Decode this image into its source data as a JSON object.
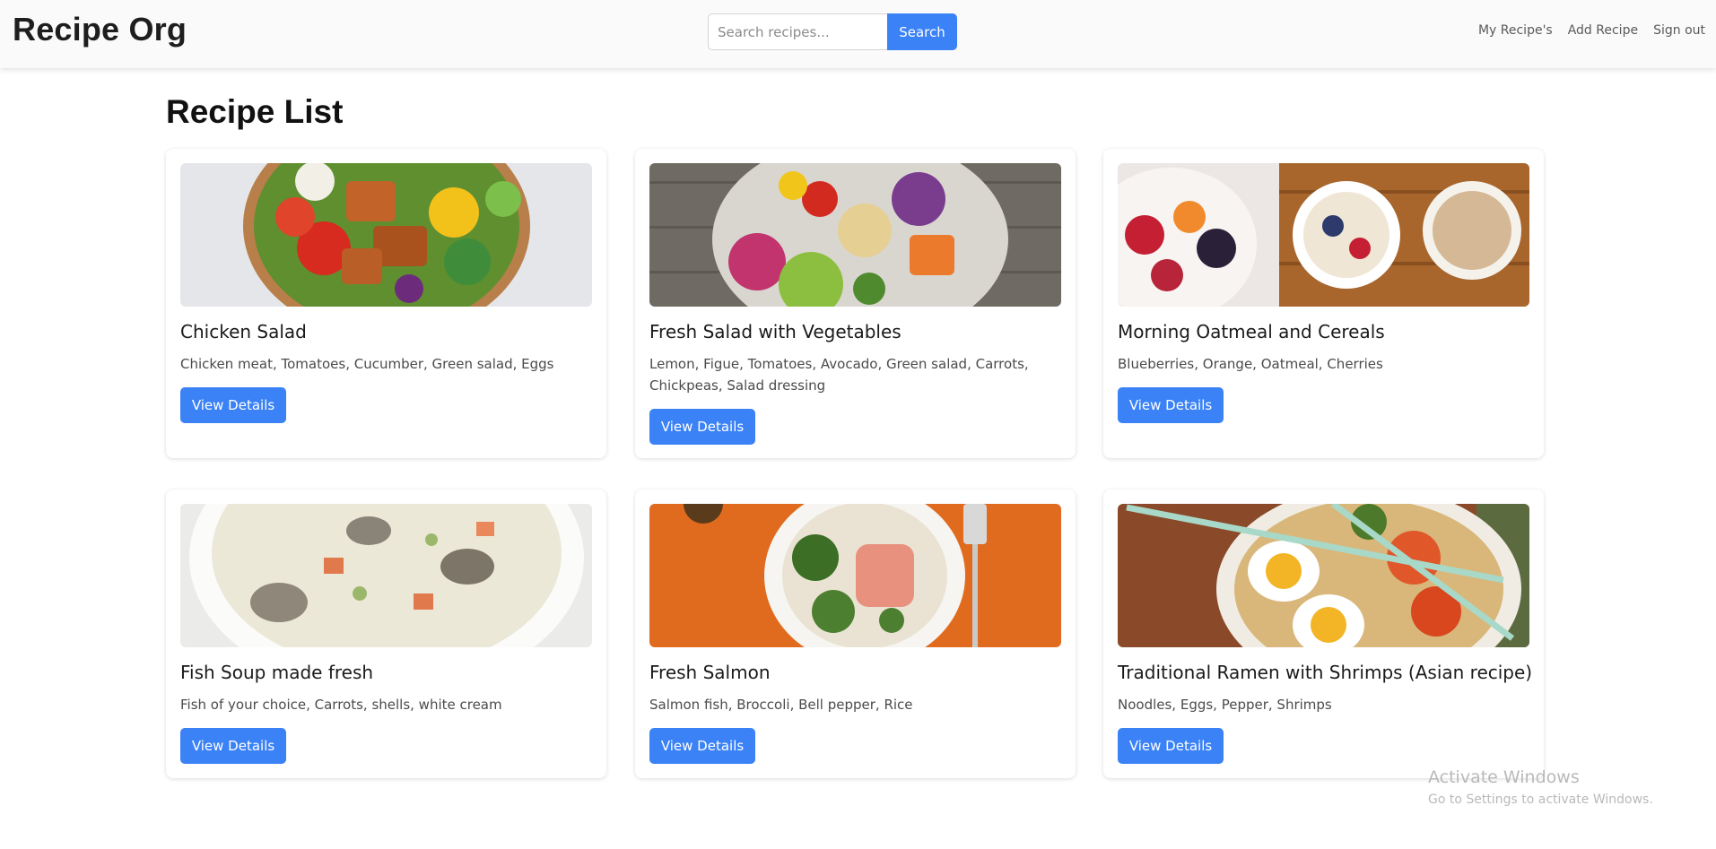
{
  "header": {
    "brand": "Recipe Org",
    "search_placeholder": "Search recipes...",
    "search_button": "Search",
    "nav": [
      "My Recipe's",
      "Add Recipe",
      "Sign out"
    ]
  },
  "main": {
    "title": "Recipe List",
    "recipes": [
      {
        "title": "Chicken Salad",
        "ingredients": "Chicken meat, Tomatoes, Cucumber, Green salad, Eggs",
        "button": "View Details"
      },
      {
        "title": "Fresh Salad with Vegetables",
        "ingredients": "Lemon, Figue, Tomatoes, Avocado, Green salad, Carrots, Chickpeas, Salad dressing",
        "button": "View Details"
      },
      {
        "title": "Morning Oatmeal and Cereals",
        "ingredients": "Blueberries, Orange, Oatmeal, Cherries",
        "button": "View Details"
      },
      {
        "title": "Fish Soup made fresh",
        "ingredients": "Fish of your choice, Carrots, shells, white cream",
        "button": "View Details"
      },
      {
        "title": "Fresh Salmon",
        "ingredients": "Salmon fish, Broccoli, Bell pepper, Rice",
        "button": "View Details"
      },
      {
        "title": "Traditional Ramen with Shrimps (Asian recipe)",
        "ingredients": "Noodles, Eggs, Pepper, Shrimps",
        "button": "View Details"
      }
    ]
  },
  "watermark": {
    "title": "Activate Windows",
    "subtitle": "Go to Settings to activate Windows."
  },
  "colors": {
    "accent": "#3b82f6",
    "navbar_bg": "#fafafa",
    "page_bg": "#ffffff"
  }
}
